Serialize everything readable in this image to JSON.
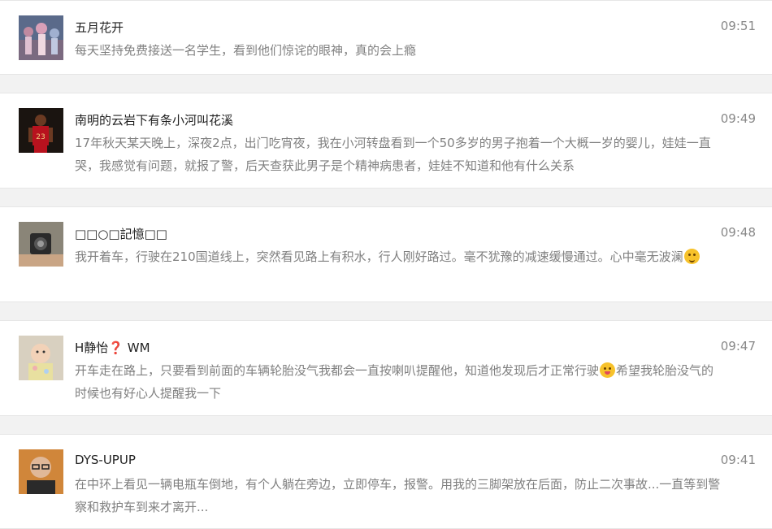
{
  "comments": [
    {
      "name": "五月花开",
      "time": "09:51",
      "text": "每天坚持免费接送一名学生，看到他们惊诧的眼神，真的会上瘾"
    },
    {
      "name": "南明的云岩下有条小河叫花溪",
      "time": "09:49",
      "text": "17年秋天某天晚上，深夜2点，出门吃宵夜，我在小河转盘看到一个50多岁的男子抱着一个大概一岁的婴儿，娃娃一直哭，我感觉有问题，就报了警，后天查获此男子是个精神病患者，娃娃不知道和他有什么关系"
    },
    {
      "name": "□□○□記憶□□",
      "time": "09:48",
      "text": "我开着车，行驶在210国道线上，突然看见路上有积水，行人刚好路过。毫不犹豫的减速缓慢通过。心中毫无波澜",
      "emoji": "thinking-emoji"
    },
    {
      "name_pre": "H静怡",
      "name_mark": "❓",
      "name_post": " WM",
      "time": "09:47",
      "text_pre": "开车走在路上，只要看到前面的车辆轮胎没气我都会一直按喇叭提醒他，知道他发现后才正常行驶",
      "emoji": "tongue-out-emoji",
      "text_post": "希望我轮胎没气的时候也有好心人提醒我一下"
    },
    {
      "name": "DYS-UPUP",
      "time": "09:41",
      "text": "在中环上看见一辆电瓶车倒地，有个人躺在旁边，立即停车，报警。用我的三脚架放在后面，防止二次事故...一直等到警察和救护车到来才离开..."
    }
  ],
  "colors": {
    "name": "#222222",
    "time": "#888888",
    "text": "#808080",
    "background": "#f2f2f2",
    "card": "#ffffff"
  }
}
